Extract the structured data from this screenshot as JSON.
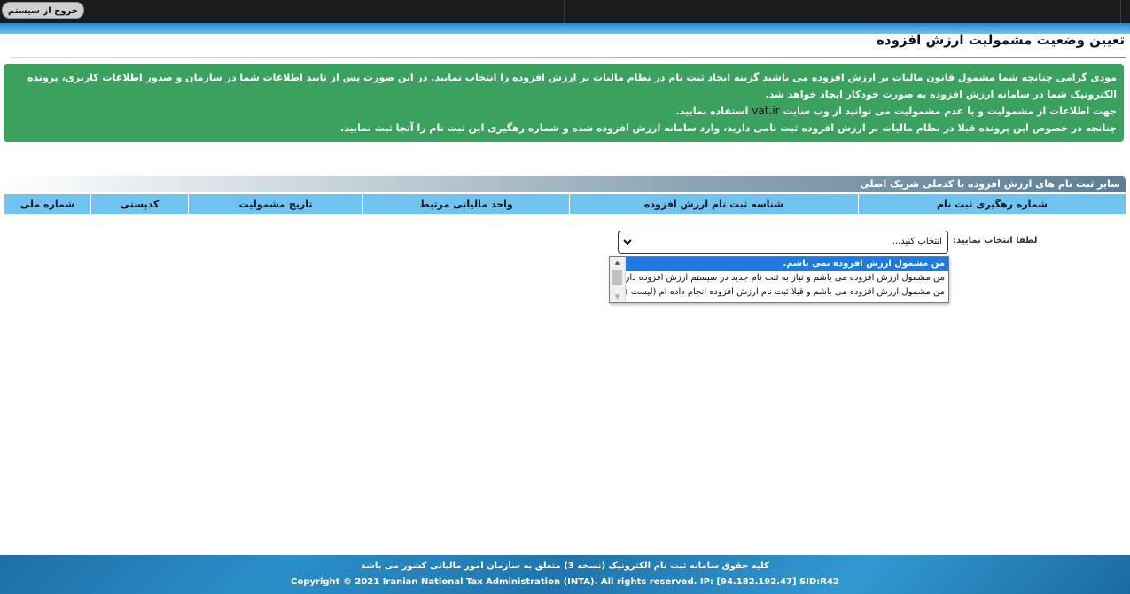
{
  "topbar": {
    "logout_label": "خروج از سیستم"
  },
  "page": {
    "title": "تعیین وضعیت مشمولیت ارزش افزوده"
  },
  "notice": {
    "line1": "مودی گرامی چنانچه شما مشمول قانون مالیات بر ارزش افزوده می باشید گزینه ایجاد ثبت نام در نظام مالیات بر ارزش افزوده را انتخاب نمایید. در این صورت پس از تایید اطلاعات شما در سازمان و صدور اطلاعات کاربری، پرونده الکترونیک شما در سامانه ارزش افزوده به صورت خودکار ایجاد خواهد شد.",
    "line2_before": "جهت اطلاعات از مشمولیت و یا عدم مشمولیت می توانید از وب سایت",
    "line2_site": "vat.ir",
    "line2_after": "استفاده نمایید.",
    "line3": "چنانچه در خصوص این پرونده قبلا در نظام مالیات بر ارزش افزوده ثبت نامی دارید، وارد سامانه ارزش افزوده شده و شماره رهگیری این ثبت نام را آنجا ثبت نمایید."
  },
  "section": {
    "title": "سایر ثبت نام های ارزش افزوده با کدملی شریک اصلی"
  },
  "table": {
    "columns": [
      "شماره رهگیری ثبت نام",
      "شناسه ثبت نام ارزش افزوده",
      "واحد مالیاتی مرتبط",
      "تاریخ مشمولیت",
      "کدپستی",
      "شماره ملی"
    ]
  },
  "select": {
    "label": "لطفا انتخاب نمایید:",
    "value": "انتخاب کنید...",
    "options": [
      "من مشمول ارزش افزوده نمی باشم.",
      "من مشمول ارزش افزوده می باشم و نیاز به ثبت نام جدید در سیستم ارزش افزوده دارم.",
      "من مشمول ارزش افزوده می باشم و قبلا ثبت نام ارزش افزوده انجام داده ام (لیست فوق)."
    ]
  },
  "footer": {
    "line1": "کلیه حقوق سامانه ثبت نام الکترونیک (نسخه 3) متعلق به سازمان امور مالیاتی کشور می باشد",
    "line2": "Copyright © 2021 Iranian National Tax Administration (INTA). All rights reserved. IP: [94.182.192.47] SID:R42"
  }
}
